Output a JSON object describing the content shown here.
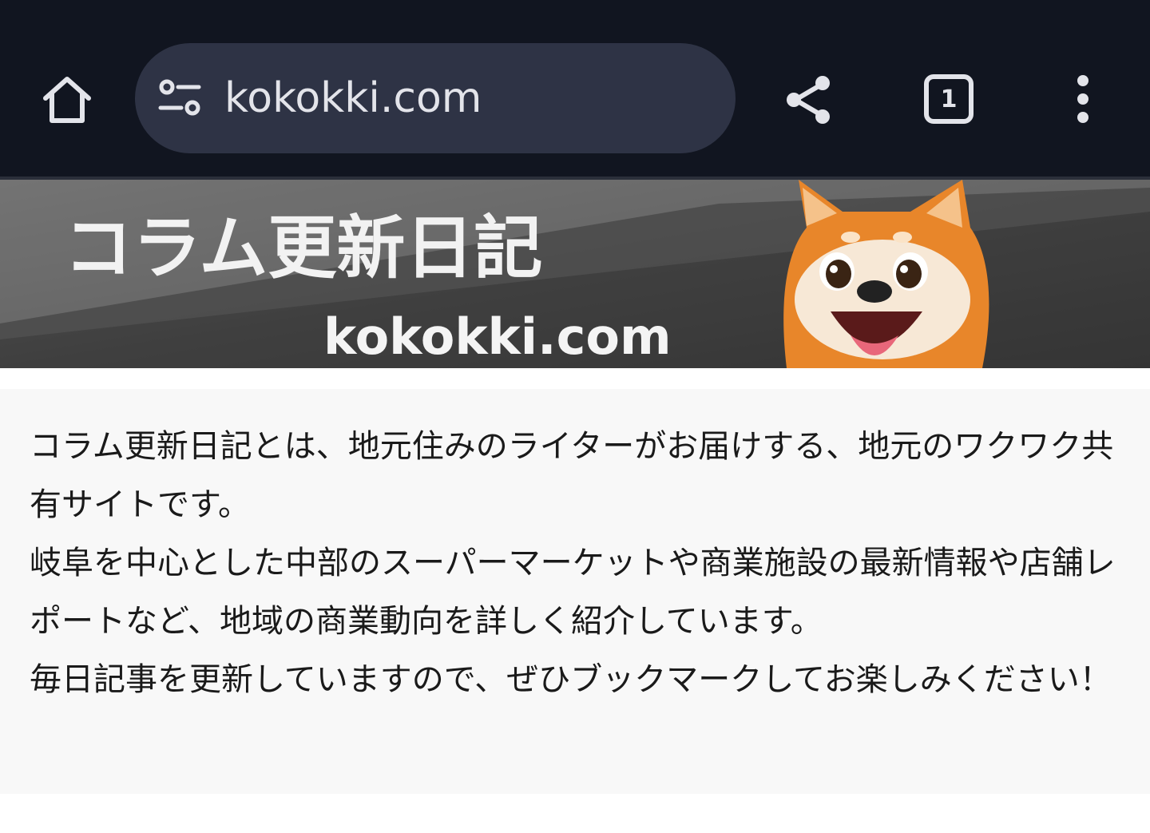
{
  "browser": {
    "url": "kokokki.com",
    "tab_count": "1",
    "icons": {
      "home": "home-icon",
      "site_settings": "tune-icon",
      "share": "share-icon",
      "tabs": "tab-switcher-icon",
      "menu": "more-vert-icon"
    },
    "colors": {
      "toolbar": "#111520",
      "omnibox": "#2e3345",
      "icon": "#e3e4ea"
    }
  },
  "banner": {
    "title": "コラム更新日記",
    "domain": "kokokki.com",
    "mascot": "shiba-inu-illustration"
  },
  "intro": {
    "lines": [
      "コラム更新日記とは、地元住みのライターがお届けする、地元のワクワク共有サイトです。",
      "岐阜を中心とした中部のスーパーマーケットや商業施設の最新情報や店舗レポートなど、地域の商業動向を詳しく紹介しています。",
      "毎日記事を更新していますので、ぜひブックマークしてお楽しみください！"
    ]
  }
}
